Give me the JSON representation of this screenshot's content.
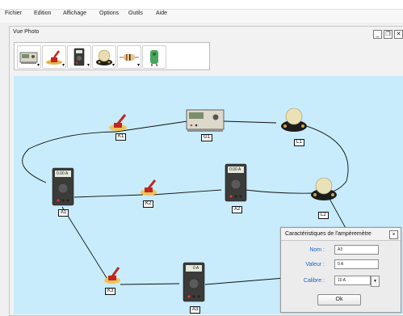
{
  "menu": {
    "items": [
      "Fichier",
      "Edition",
      "Affichage",
      "Options",
      "Outils",
      "Aide"
    ]
  },
  "window": {
    "title": "Vue Photo",
    "minimize": "_",
    "maximize": "❐",
    "close": "✕"
  },
  "toolbar": {
    "tools": [
      "generator-tool",
      "switch-tool",
      "multimeter-tool",
      "lamp-tool",
      "resistor-tool",
      "component-tool"
    ]
  },
  "circuit": {
    "labels": {
      "K1": "K1",
      "G1": "G1",
      "L1": "L1",
      "A1": "A1",
      "K2": "K2",
      "A2": "A2",
      "L2": "L2",
      "K3": "K3",
      "A3": "A3"
    },
    "meter_readings": {
      "A1": "0.00 A",
      "A2": "0.00 A",
      "A3": "0 A"
    }
  },
  "dialog": {
    "title": "Caractéristiques de l'ampèremètre",
    "close": "×",
    "nom_label": "Nom :",
    "nom_value": "A3",
    "valeur_label": "Valeur :",
    "valeur_value": "0 A",
    "calibre_label": "Calibre :",
    "calibre_value": "10 A",
    "ok_label": "Ok"
  },
  "colors": {
    "canvas_background": "#c8ecfb",
    "label_accent": "#1f5fc9"
  }
}
